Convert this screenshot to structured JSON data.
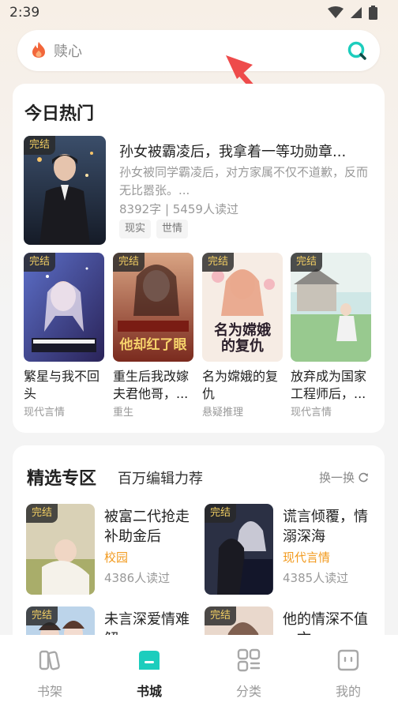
{
  "status": {
    "time": "2:39"
  },
  "search": {
    "placeholder": "赎心"
  },
  "hot": {
    "title": "今日热门",
    "featured": {
      "badge": "完结",
      "title": "孙女被霸凌后，我拿着一等功勋章...",
      "desc": "孙女被同学霸凌后，对方家属不仅不道歉，反而无比嚣张。...",
      "meta": "8392字 | 5459人读过",
      "tags": [
        "现实",
        "世情"
      ]
    },
    "grid": [
      {
        "badge": "完结",
        "title": "繁星与我不回头",
        "category": "现代言情"
      },
      {
        "badge": "完结",
        "title": "重生后我改嫁夫君他哥，...",
        "category": "重生"
      },
      {
        "badge": "完结",
        "title": "名为嫦娥的复仇",
        "category": "悬疑推理"
      },
      {
        "badge": "完结",
        "title": "放弃成为国家工程师后，...",
        "category": "现代言情"
      }
    ]
  },
  "picks": {
    "title": "精选专区",
    "subtitle": "百万编辑力荐",
    "refresh": "换一换",
    "items": [
      {
        "badge": "完结",
        "title": "被富二代抢走补助金后",
        "category": "校园",
        "reads": "4386人读过"
      },
      {
        "badge": "完结",
        "title": "谎言倾覆，情溺深海",
        "category": "现代言情",
        "reads": "4385人读过"
      },
      {
        "badge": "完结",
        "title": "未言深爱情难解",
        "category": "",
        "reads": ""
      },
      {
        "badge": "完结",
        "title": "他的情深不值一文",
        "category": "",
        "reads": ""
      }
    ]
  },
  "tabs": [
    {
      "label": "书架",
      "icon": "bookshelf-icon"
    },
    {
      "label": "书城",
      "icon": "bookstore-icon"
    },
    {
      "label": "分类",
      "icon": "category-icon"
    },
    {
      "label": "我的",
      "icon": "profile-icon"
    }
  ],
  "colors": {
    "accent": "#1ccdbd",
    "badge_text": "#f3cf63",
    "category_orange": "#f29a1e"
  }
}
